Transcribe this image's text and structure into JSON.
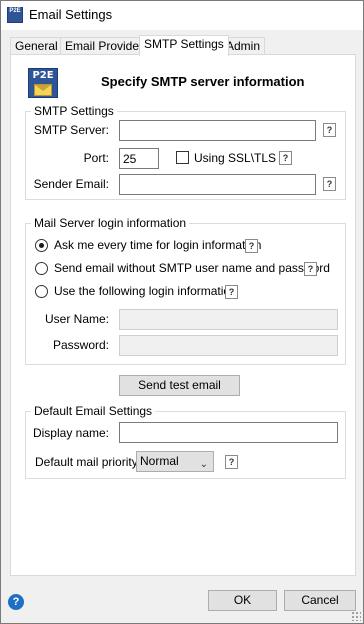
{
  "window": {
    "title": "Email Settings",
    "icon": "p2e-app-icon",
    "icon_text": "P2E"
  },
  "tabs": [
    {
      "label": "General"
    },
    {
      "label": "Email Provider"
    },
    {
      "label": "SMTP Settings"
    },
    {
      "label": "Admin"
    }
  ],
  "active_tab": "SMTP Settings",
  "header": {
    "logo_text": "P2E",
    "title": "Specify SMTP server information"
  },
  "smtp": {
    "legend": "SMTP Settings",
    "server_label": "SMTP Server:",
    "server_value": "",
    "port_label": "Port:",
    "port_value": "25",
    "ssl_label": "Using SSL\\TLS",
    "ssl_checked": false,
    "sender_label": "Sender Email:",
    "sender_value": ""
  },
  "login": {
    "legend": "Mail Server login information",
    "options": [
      {
        "label": "Ask me every time for login information",
        "checked": true
      },
      {
        "label": "Send email without SMTP user name and password",
        "checked": false
      },
      {
        "label": "Use the following login information",
        "checked": false
      }
    ],
    "username_label": "User Name:",
    "username_value": "",
    "password_label": "Password:",
    "password_value": ""
  },
  "test_button": "Send test email",
  "defaults": {
    "legend": "Default Email Settings",
    "display_label": "Display name:",
    "display_value": "",
    "priority_label": "Default mail priority:",
    "priority_value": "Normal"
  },
  "footer": {
    "help_glyph": "?",
    "ok_label": "OK",
    "cancel_label": "Cancel"
  },
  "help_glyph": "?",
  "colors": {
    "window_bg": "#f0f0f0",
    "panel_bg": "#ffffff",
    "help_icon": "#1f6fc5",
    "logo": "#2f5597"
  }
}
